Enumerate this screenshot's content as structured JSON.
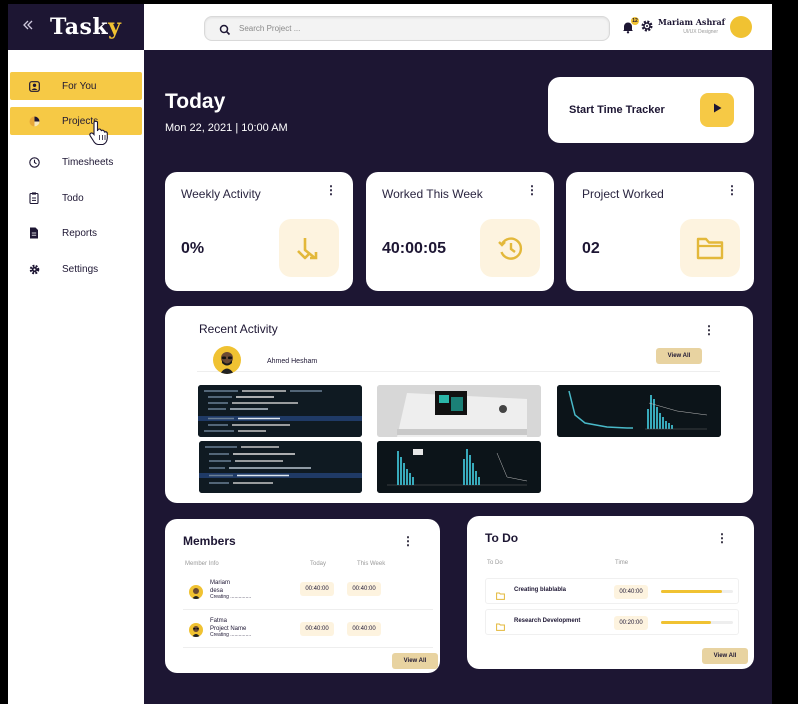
{
  "brand": {
    "back_icon": "chevrons-left-icon",
    "logo_main": "Task",
    "logo_accent": "y"
  },
  "topbar": {
    "search_placeholder": "Search Project ...",
    "notification_count": "12",
    "user_name": "Mariam Ashraf",
    "user_role": "UI/UX Designer"
  },
  "sidebar": {
    "items": [
      {
        "label": "For You",
        "icon": "user-icon",
        "active": true
      },
      {
        "label": "Projects",
        "icon": "pie-chart-icon",
        "active": true
      },
      {
        "label": "Timesheets",
        "icon": "clock-icon",
        "active": false
      },
      {
        "label": "Todo",
        "icon": "clipboard-icon",
        "active": false
      },
      {
        "label": "Reports",
        "icon": "document-icon",
        "active": false
      },
      {
        "label": "Settings",
        "icon": "gear-icon",
        "active": false
      }
    ]
  },
  "main": {
    "title": "Today",
    "date": "Mon 22, 2021 | 10:00 AM",
    "tracker_label": "Start Time Tracker",
    "stats": [
      {
        "title": "Weekly Activity",
        "value": "0%",
        "icon": "arrows-merge-icon"
      },
      {
        "title": "Worked This Week",
        "value": "40:00:05",
        "icon": "history-clock-icon"
      },
      {
        "title": "Project Worked",
        "value": "02",
        "icon": "folder-icon"
      }
    ],
    "recent": {
      "title": "Recent Activity",
      "user": "Ahmed Hesham",
      "view_all": "View All"
    },
    "members": {
      "title": "Members",
      "columns": [
        "Member Info",
        "Today",
        "This Week"
      ],
      "rows": [
        {
          "name": "Mariam",
          "sub": "desa",
          "status": "Creating ...............",
          "today": "00:40:00",
          "week": "00:40:00"
        },
        {
          "name": "Fatma",
          "sub": "Project Name",
          "status": "Creating ...............",
          "today": "00:40:00",
          "week": "00:40:00"
        }
      ],
      "view_all": "View All"
    },
    "todo": {
      "title": "To Do",
      "columns": [
        "To Do",
        "Time"
      ],
      "rows": [
        {
          "name": "Creating blablabla",
          "time": "00:40:00",
          "progress": 0.85
        },
        {
          "name": "Research Development",
          "time": "00:20:00",
          "progress": 0.7
        }
      ],
      "view_all": "View All"
    }
  },
  "colors": {
    "accent": "#f6c945",
    "background": "#1d1633",
    "card": "#ffffff",
    "icon_bg": "#fdf3df"
  }
}
